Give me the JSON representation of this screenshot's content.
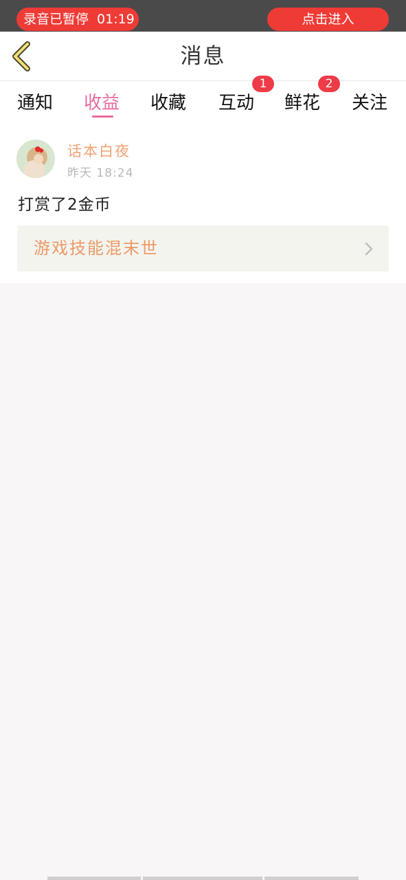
{
  "recording": {
    "status": "录音已暂停",
    "time": "01:19",
    "enter_label": "点击进入",
    "accent": "#ef3b36"
  },
  "header": {
    "title": "消息",
    "back_icon": "chevron-left-icon"
  },
  "tabs": [
    {
      "label": "通知",
      "active": false,
      "badge": null
    },
    {
      "label": "收益",
      "active": true,
      "badge": null
    },
    {
      "label": "收藏",
      "active": false,
      "badge": null
    },
    {
      "label": "互动",
      "active": false,
      "badge": "1"
    },
    {
      "label": "鲜花",
      "active": false,
      "badge": "2"
    },
    {
      "label": "关注",
      "active": false,
      "badge": null
    }
  ],
  "message": {
    "user_name": "话本白夜",
    "time": "昨天 18:24",
    "text": "打赏了2金币",
    "book_title": "游戏技能混末世",
    "avatar_icon": "user-avatar"
  },
  "colors": {
    "tab_active": "#e86ba0",
    "user_name": "#f0a274",
    "book_title": "#ec9a65",
    "badge": "#ef3b47"
  }
}
